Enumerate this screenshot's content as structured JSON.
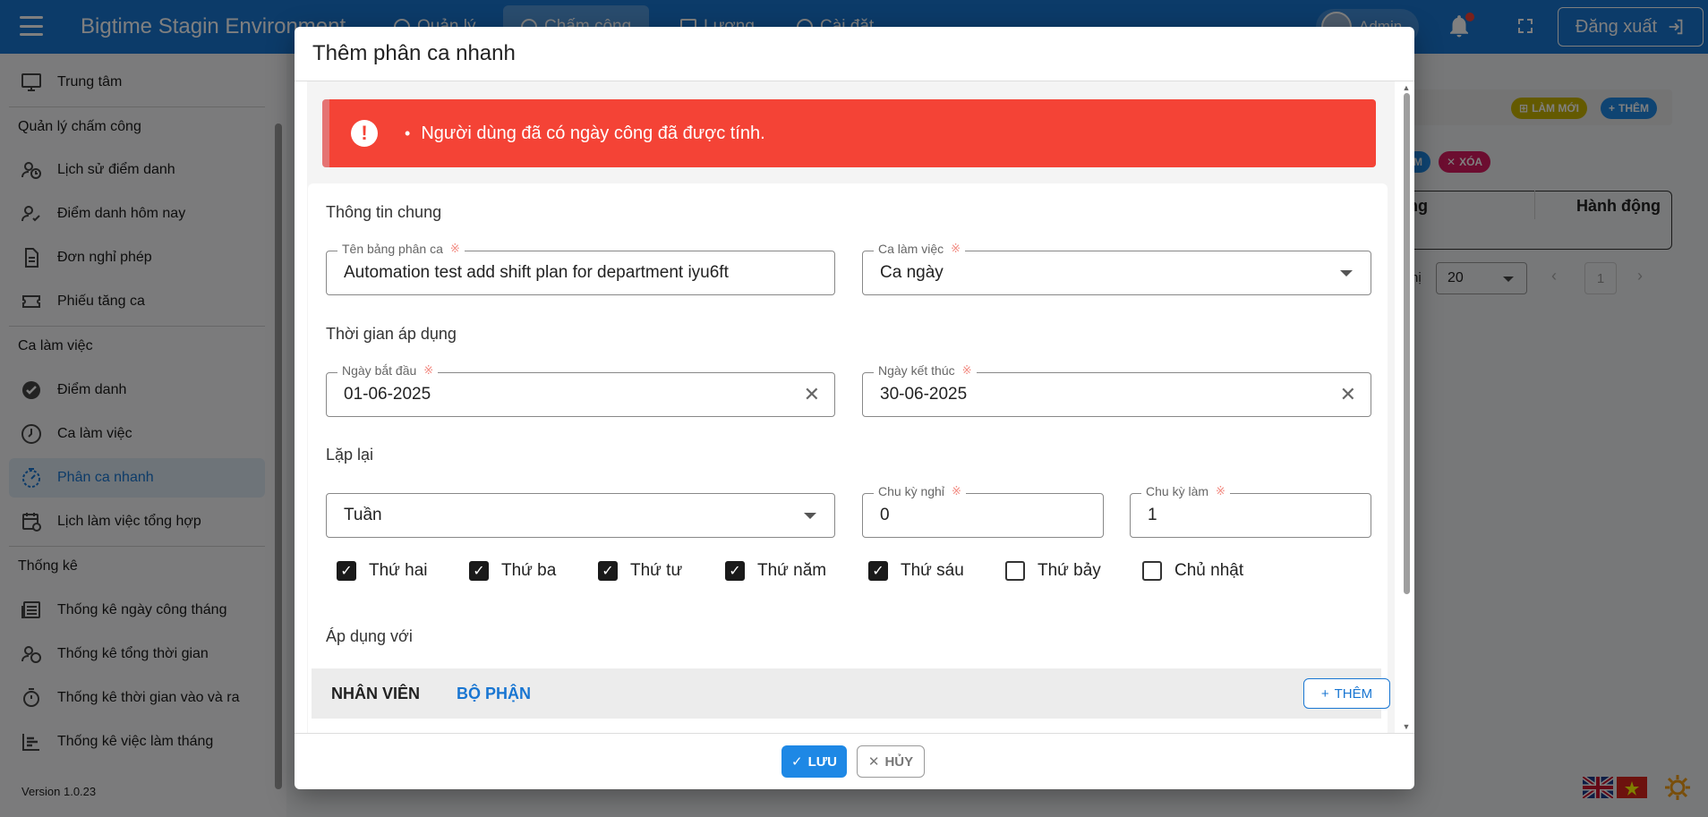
{
  "app": {
    "title": "Bigtime Stagin Environment"
  },
  "topnav": {
    "tabs": [
      {
        "label": "Quản lý"
      },
      {
        "label": "Chấm công"
      },
      {
        "label": "Lương"
      },
      {
        "label": "Cài đặt"
      }
    ],
    "user": "Admin",
    "logout_label": "Đăng xuất"
  },
  "sidebar": {
    "home": "Trung tâm",
    "section_attendance": "Quản lý chấm công",
    "attendance_items": [
      "Lịch sử điểm danh",
      "Điểm danh hôm nay",
      "Đơn nghỉ phép",
      "Phiếu tăng ca"
    ],
    "section_shift": "Ca làm việc",
    "shift_items": [
      "Điểm danh",
      "Ca làm việc",
      "Phân ca nhanh",
      "Lịch làm việc tổng hợp"
    ],
    "section_stats": "Thống kê",
    "stats_items": [
      "Thống kê ngày công tháng",
      "Thống kê tổng thời gian",
      "Thống kê thời gian vào và ra",
      "Thống kê việc làm tháng"
    ],
    "version": "Version 1.0.23"
  },
  "background": {
    "refresh_label": "LÀM MỚI",
    "add_label": "THÊM",
    "delete_label": "XÓA",
    "partial_chip": "M",
    "col_partial": "ng",
    "col_action": "Hành động",
    "rows_label_partial": "hị",
    "page_size": "20",
    "current_page": "1"
  },
  "modal": {
    "title": "Thêm phân ca nhanh",
    "error_message": "Người dùng đã có ngày công đã được tính.",
    "section_general": "Thông tin chung",
    "plan_name_label": "Tên bảng phân ca",
    "plan_name_value": "Automation test add shift plan for department iyu6ft",
    "shift_label": "Ca làm việc",
    "shift_value": "Ca ngày",
    "section_time": "Thời gian áp dụng",
    "start_label": "Ngày bắt đầu",
    "start_value": "01-06-2025",
    "end_label": "Ngày kết thúc",
    "end_value": "30-06-2025",
    "section_repeat": "Lặp lại",
    "repeat_value": "Tuần",
    "off_cycle_label": "Chu kỳ nghỉ",
    "off_cycle_value": "0",
    "work_cycle_label": "Chu kỳ làm",
    "work_cycle_value": "1",
    "required_mark": "※",
    "weekdays": [
      {
        "label": "Thứ hai",
        "checked": true
      },
      {
        "label": "Thứ ba",
        "checked": true
      },
      {
        "label": "Thứ tư",
        "checked": true
      },
      {
        "label": "Thứ năm",
        "checked": true
      },
      {
        "label": "Thứ sáu",
        "checked": true
      },
      {
        "label": "Thứ bảy",
        "checked": false
      },
      {
        "label": "Chủ nhật",
        "checked": false
      }
    ],
    "section_apply": "Áp dụng với",
    "tab_employee": "NHÂN VIÊN",
    "tab_department": "BỘ PHẬN",
    "add_label": "THÊM",
    "save_label": "LƯU",
    "cancel_label": "HỦY"
  },
  "colors": {
    "primary": "#1976d2",
    "error": "#f44336",
    "refresh_chip": "#c8b400",
    "delete_chip": "#d81b60"
  }
}
